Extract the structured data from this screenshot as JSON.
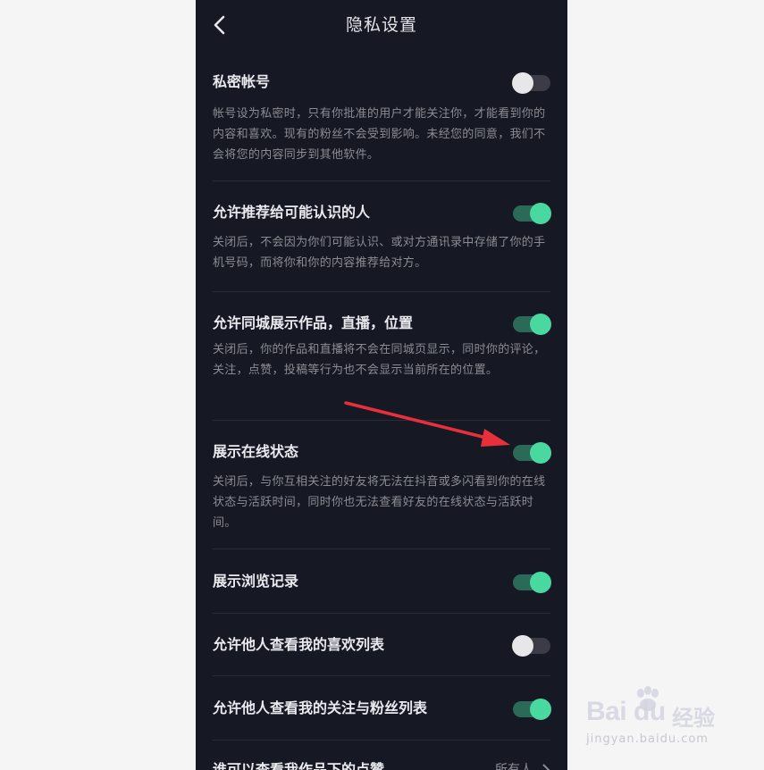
{
  "header": {
    "title": "隐私设置"
  },
  "settings": [
    {
      "title": "私密帐号",
      "desc": "帐号设为私密时，只有你批准的用户才能关注你，才能看到你的内容和喜欢。现有的粉丝不会受到影响。未经您的同意，我们不会将您的内容同步到其他软件。",
      "enabled": false
    },
    {
      "title": "允许推荐给可能认识的人",
      "desc": "关闭后，不会因为你们可能认识、或对方通讯录中存储了你的手机号码，而将你和你的内容推荐给对方。",
      "enabled": true
    },
    {
      "title": "允许同城展示作品，直播，位置",
      "desc": "关闭后，你的作品和直播将不会在同城页显示，同时你的评论，关注，点赞，投稿等行为也不会显示当前所在的位置。",
      "enabled": true
    },
    {
      "title": "展示在线状态",
      "desc": "关闭后，与你互相关注的好友将无法在抖音或多闪看到你的在线状态与活跃时间，同时你也无法查看好友的在线状态与活跃时间。",
      "enabled": true
    },
    {
      "title": "展示浏览记录",
      "enabled": true
    },
    {
      "title": "允许他人查看我的喜欢列表",
      "enabled": false
    },
    {
      "title": "允许他人查看我的关注与粉丝列表",
      "enabled": true
    }
  ],
  "last_row": {
    "title": "谁可以查看我作品下的点赞",
    "value": "所有人"
  },
  "colors": {
    "background": "#161823",
    "toggle_on": "#4ad8a1",
    "annotation_arrow": "#e8303b"
  },
  "watermark": {
    "logo": "Bai du",
    "brand_cn": "经验",
    "url": "jingyan.baidu.com"
  }
}
